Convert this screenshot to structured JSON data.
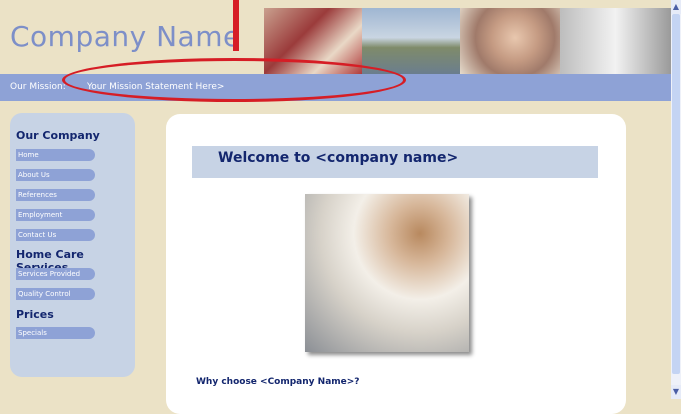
{
  "header": {
    "company_name": "Company Name"
  },
  "mission": {
    "label": "Our Mission:",
    "statement": "Your Mission Statement Here>"
  },
  "sidebar": {
    "section1": "Our Company",
    "items1": [
      "Home",
      "About Us",
      "References",
      "Employment",
      "Contact Us"
    ],
    "section2": "Home Care Services",
    "items2": [
      "Services Provided",
      "Quality Control"
    ],
    "section3": "Prices",
    "items3": [
      "Specials"
    ]
  },
  "main": {
    "welcome": "Welcome to <company name>",
    "why": "Why choose <Company Name>?"
  },
  "scrollbar": {
    "up": "▲",
    "down": "▼"
  },
  "colors": {
    "accent": "#8ea2d6",
    "annotation": "#d61d25",
    "heading": "#13266e"
  }
}
